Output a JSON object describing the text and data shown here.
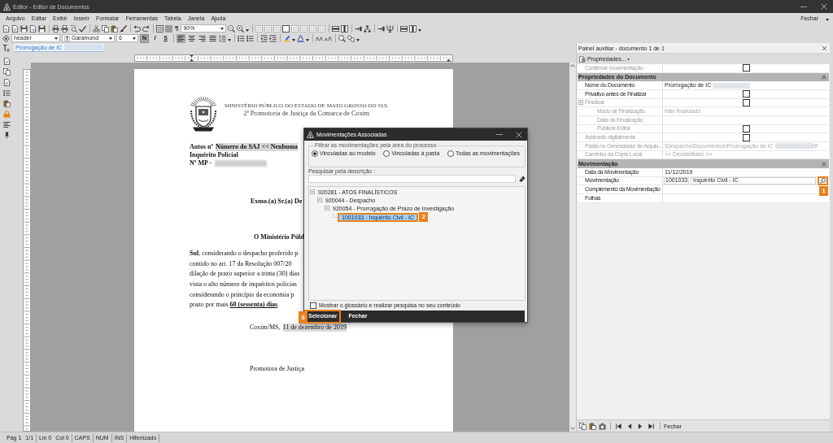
{
  "window": {
    "title": "Editor - Editor de Documentos",
    "close_menu": "Fechar"
  },
  "menu": [
    "Arquivo",
    "Editar",
    "Exibir",
    "Inserir",
    "Formatar",
    "Ferramentas",
    "Tabela",
    "Janela",
    "Ajuda"
  ],
  "toolbar": {
    "pilcrow": "¶",
    "zoom": "90%"
  },
  "format_bar": {
    "style": "header",
    "font": "Garamond",
    "size": "6",
    "text_styles": [
      {
        "kind": "bold",
        "label": "N",
        "selected": true
      },
      {
        "kind": "italic",
        "label": "I",
        "selected": false
      },
      {
        "kind": "underline",
        "label": "S",
        "selected": false
      }
    ],
    "alignments": [
      {
        "kind": "left",
        "selected": true
      },
      {
        "kind": "center",
        "selected": false
      },
      {
        "kind": "right",
        "selected": false
      },
      {
        "kind": "justify",
        "selected": false
      }
    ]
  },
  "document_name": {
    "value": "Prorrogação de IC",
    "blurred": true
  },
  "document": {
    "header": {
      "organization": "MINISTÉRIO PÚBLICO DO ESTADO DE MATO GROSSO DO SUL",
      "unit": "2ª Promotoria de Justiça da Comarca de Coxim"
    },
    "case_lines": [
      {
        "label": "Autos nº",
        "field": "Número do SAJ << Nenhuma"
      },
      {
        "label": "Inquérito Policial"
      },
      {
        "label": "Nº MP -",
        "blurred": true
      }
    ],
    "addressee": "Exmo.(a) Sr.(a) De",
    "opening": "O Ministério Públ",
    "body_lines": [
      "**Sul**, considerando o despacho proferido p",
      "contido no art. 17 da Resolução 007/20",
      "dilação de prazo superior a trinta (30) dias",
      "vista o alto número de inquéritos policias",
      "considerando o princípio da economia p"
    ],
    "closing_line": {
      "text": "prazo por mais ",
      "term": "60 (sessenta) dias",
      "end": "."
    },
    "place_date": {
      "place": "Coxim/MS,",
      "date": "11 de dezembro de 2019"
    },
    "signature": "Promotora de Justiça"
  },
  "dialog": {
    "title": "Movimentações Associadas",
    "filter": {
      "legend": "Filtrar as movimentações pela área do processo",
      "options": [
        {
          "label": "Vinculadas ao modelo",
          "selected": true
        },
        {
          "label": "Vinculadas à pasta",
          "selected": false
        },
        {
          "label": "Todas as movimentações",
          "selected": false
        }
      ]
    },
    "search_label": "Pesquisar pela descrição :",
    "tree": [
      {
        "label": "920281 - ATOS FINALÍSTICOS",
        "selected": false,
        "expanded": true,
        "children": [
          {
            "label": "920044 - Despacho",
            "selected": false,
            "expanded": true,
            "children": [
              {
                "label": "920054 - Prorrogação de Prazo de Investigação",
                "selected": false,
                "expanded": true,
                "children": [
                  {
                    "label": "1001033 - Inquérito Civil - IC",
                    "selected": true,
                    "callout": "2"
                  }
                ]
              }
            ]
          }
        ]
      }
    ],
    "glossary": {
      "label": "Mostrar o glossário e realizar pesquisa no seu conteúdo",
      "checked": false
    },
    "buttons": [
      {
        "label": "Selecionar",
        "callout": "3"
      },
      {
        "label": "Fechar"
      }
    ]
  },
  "panel": {
    "title": "Painel auxiliar - documento 1 de 1",
    "menu": "Propriedades...",
    "rows": [
      {
        "kind": "checkbox",
        "label": "Confirmar movimentação",
        "disabled": true,
        "checked": false
      },
      {
        "kind": "section",
        "label": "Propriedades do Documento",
        "expanded": true
      },
      {
        "kind": "text",
        "label": "Nome do Documento",
        "disabled": false,
        "value": "Prorrogação de IC",
        "blurred": true
      },
      {
        "kind": "checkbox",
        "label": "Privativo antes de Finalizar",
        "disabled": false,
        "checked": false
      },
      {
        "kind": "checkbox",
        "label": "Finalizar",
        "disabled": true,
        "checked": false,
        "expanded": true,
        "children": [
          {
            "kind": "text",
            "label": "Modo de Finalização",
            "disabled": true,
            "value": "Não finalizado"
          },
          {
            "kind": "text",
            "label": "Data da Finalização",
            "disabled": true
          },
          {
            "kind": "checkbox",
            "label": "Publicar Edital",
            "disabled": true,
            "checked": false
          }
        ]
      },
      {
        "kind": "checkbox",
        "label": "Assinado digitalmente",
        "disabled": true,
        "checked": false
      },
      {
        "kind": "text",
        "label": "Pasta no Gerenciador de Arquiv...",
        "disabled": true,
        "value": "\\Despacho\\Documentos\\Prorrogação de IC",
        "blurred": true,
        "suffix": "rtf"
      },
      {
        "kind": "text",
        "label": "Caminho da Cópia Local",
        "disabled": true,
        "value": "<< Desabilitado >>"
      },
      {
        "kind": "section",
        "label": "Movimentação",
        "expanded": true
      },
      {
        "kind": "text",
        "label": "Data da Movimentação",
        "disabled": false,
        "value": "11/12/2019"
      },
      {
        "kind": "lookup",
        "label": "Movimentação",
        "disabled": false,
        "code": "1001033",
        "value": "Inquérito Civil - IC",
        "callout": "1"
      },
      {
        "kind": "text",
        "label": "Complemento da Movimentação",
        "disabled": false
      },
      {
        "kind": "text",
        "label": "Folhas",
        "disabled": false
      }
    ],
    "footer_close": "Fechar"
  },
  "status_bar": [
    {
      "texts": [
        "Pág 1",
        "1/1"
      ]
    },
    {
      "texts": [
        "Lin 0",
        "Col 0"
      ]
    },
    {
      "texts": [
        "CAPS"
      ]
    },
    {
      "texts": [
        "NUM"
      ]
    },
    {
      "texts": [
        "INS"
      ]
    },
    {
      "texts": [
        "Hifenizado"
      ]
    }
  ]
}
